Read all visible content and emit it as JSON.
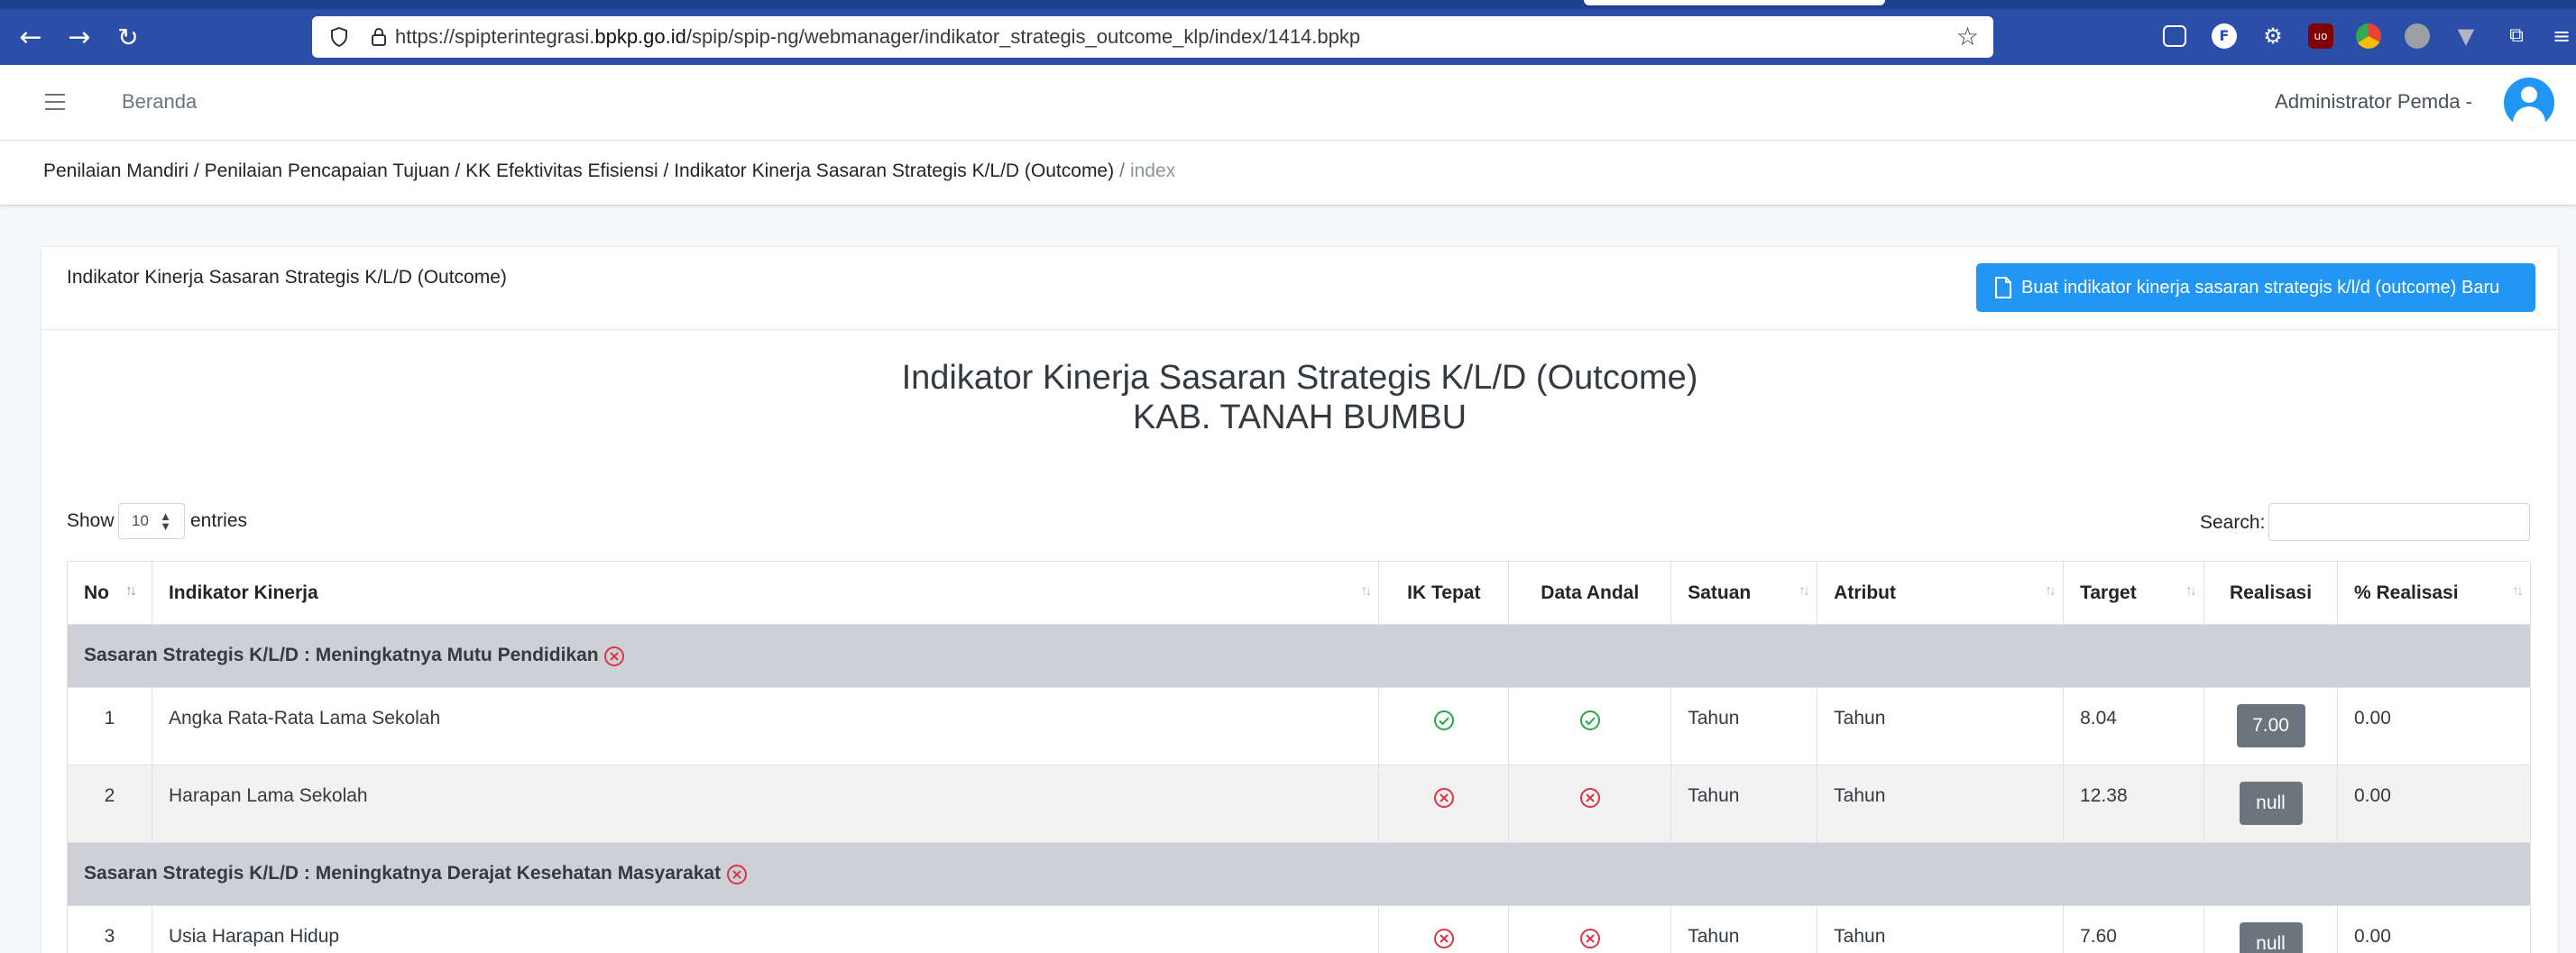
{
  "browser": {
    "url_prefix": "https://spipterintegrasi.",
    "url_domain": "bpkp.go.id",
    "url_path": "/spip/spip-ng/webmanager/indikator_strategis_outcome_klp/index/1414.bpkp",
    "back_icon": "arrow-left-icon",
    "forward_icon": "arrow-right-icon",
    "reload_icon": "reload-icon",
    "bookmark_icon": "star-icon",
    "extensions": [
      "pocket-icon",
      "f-extension-icon",
      "gear-extension-icon",
      "ublock-icon",
      "chrome-icon",
      "globe-icon",
      "vue-icon",
      "extensions-puzzle-icon",
      "menu-icon"
    ]
  },
  "navbar": {
    "home_label": "Beranda",
    "user_label": "Administrator Pemda -"
  },
  "breadcrumb": {
    "path": "Penilaian Mandiri / Penilaian Pencapaian Tujuan / KK Efektivitas Efisiensi / Indikator Kinerja Sasaran Strategis K/L/D (Outcome)",
    "separator": "/",
    "active": "index"
  },
  "card": {
    "title": "Indikator Kinerja Sasaran Strategis K/L/D (Outcome)",
    "create_button": "Buat indikator kinerja sasaran strategis k/l/d (outcome) Baru",
    "heading_line1": "Indikator Kinerja Sasaran Strategis K/L/D (Outcome)",
    "heading_line2": "KAB. TANAH BUMBU",
    "show_label": "Show",
    "entries_value": "10",
    "entries_label": "entries",
    "search_label": "Search:",
    "search_value": ""
  },
  "table": {
    "headers": {
      "no": "No",
      "indikator": "Indikator Kinerja",
      "ik_tepat": "IK Tepat",
      "data_andal": "Data Andal",
      "satuan": "Satuan",
      "atribut": "Atribut",
      "target": "Target",
      "realisasi": "Realisasi",
      "pct_realisasi": "% Realisasi"
    },
    "groups": [
      {
        "title": "Sasaran Strategis K/L/D : Meningkatnya Mutu Pendidikan",
        "status_icon": "x-circle-icon",
        "rows": [
          {
            "no": "1",
            "indikator": "Angka Rata-Rata Lama Sekolah",
            "ik_tepat": "check",
            "data_andal": "check",
            "satuan": "Tahun",
            "atribut": "Tahun",
            "target": "8.04",
            "realisasi": "7.00",
            "pct_realisasi": "0.00"
          },
          {
            "no": "2",
            "indikator": "Harapan Lama Sekolah",
            "ik_tepat": "x",
            "data_andal": "x",
            "satuan": "Tahun",
            "atribut": "Tahun",
            "target": "12.38",
            "realisasi": "null",
            "pct_realisasi": "0.00"
          }
        ]
      },
      {
        "title": "Sasaran Strategis K/L/D : Meningkatnya Derajat Kesehatan Masyarakat",
        "status_icon": "x-circle-icon",
        "rows": [
          {
            "no": "3",
            "indikator": "Usia Harapan Hidup",
            "ik_tepat": "x",
            "data_andal": "x",
            "satuan": "Tahun",
            "atribut": "Tahun",
            "target": "7.60",
            "realisasi": "null",
            "pct_realisasi": "0.00"
          }
        ]
      }
    ]
  },
  "colors": {
    "browser_bar": "#2b4fa8",
    "primary": "#2196f3",
    "group_row": "#cdd1d6",
    "secondary_button": "#6c757d",
    "success": "#28a745",
    "danger": "#dc3545"
  }
}
